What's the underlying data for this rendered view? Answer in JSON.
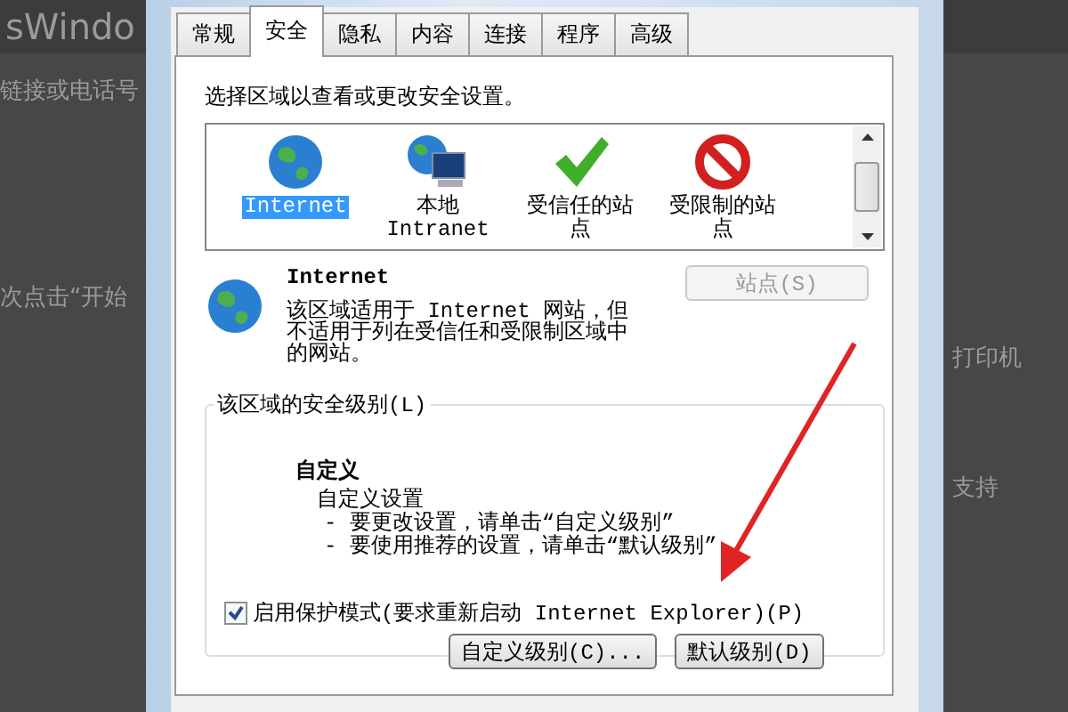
{
  "background": {
    "texts": [
      "sWindo",
      "链接或电话号",
      "次点击“开始",
      "打印机",
      "支持"
    ]
  },
  "dialog": {
    "tabs": [
      {
        "label": "常规",
        "selected": false
      },
      {
        "label": "安全",
        "selected": true
      },
      {
        "label": "隐私",
        "selected": false
      },
      {
        "label": "内容",
        "selected": false
      },
      {
        "label": "连接",
        "selected": false
      },
      {
        "label": "程序",
        "selected": false
      },
      {
        "label": "高级",
        "selected": false
      }
    ],
    "prompt": "选择区域以查看或更改安全设置。",
    "zones": [
      {
        "kind": "globe",
        "label": "Internet",
        "selected": true
      },
      {
        "kind": "intranet",
        "label": "本地 Intranet",
        "selected": false
      },
      {
        "kind": "check",
        "label": "受信任的站点",
        "selected": false
      },
      {
        "kind": "forbidden",
        "label": "受限制的站点",
        "selected": false
      }
    ],
    "zone_info": {
      "title": "Internet",
      "description": "该区域适用于 Internet 网站，但不适用于列在受信任和受限制区域中的网站。"
    },
    "sites_button": {
      "label": "站点(S)",
      "disabled": true
    },
    "level_group": {
      "legend": "该区域的安全级别(L)",
      "level_name": "自定义",
      "level_text": "自定义设置",
      "hints": [
        "- 要更改设置，请单击“自定义级别”",
        "- 要使用推荐的设置，请单击“默认级别”"
      ]
    },
    "protected_mode": {
      "label": "启用保护模式(要求重新启动 Internet Explorer)(P)",
      "checked": true
    },
    "buttons": [
      "自定义级别(C)...",
      "默认级别(D)"
    ]
  }
}
